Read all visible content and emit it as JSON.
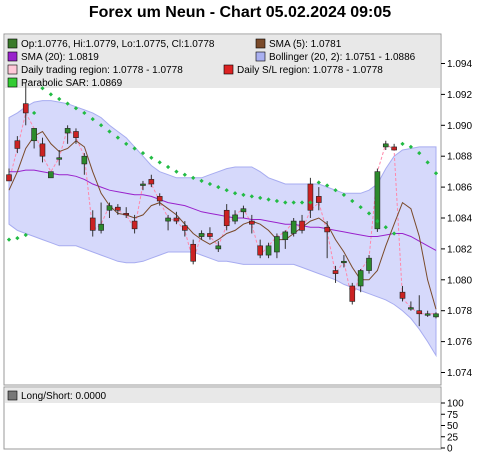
{
  "title": "Forex um Neun - Chart 05.02.2024 09:05",
  "legend": [
    {
      "text": "Op:1.0776, Hi:1.0779, Lo:1.0775, Cl:1.0778",
      "swatch": "#3a7a2a"
    },
    {
      "text": "SMA (5): 1.0781",
      "swatch": "#7a4a2a"
    },
    {
      "text": "SMA (20): 1.0819",
      "swatch": "#9922cc"
    },
    {
      "text": "Bollinger (20, 2): 1.0751 - 1.0886",
      "swatch": "#aab0f0"
    },
    {
      "text": "Daily trading region: 1.0778 - 1.0778",
      "swatch": "#ffc8d8"
    },
    {
      "text": "Daily S/L region: 1.0778 - 1.0778",
      "swatch": "#dd2222"
    },
    {
      "text": "Parabolic SAR: 1.0869",
      "swatch": "#33cc33"
    }
  ],
  "lower_panel": {
    "legend": "Long/Short: 0.0000",
    "swatch": "#777777",
    "y_ticks": [
      "100",
      "75",
      "50",
      "25",
      "0"
    ]
  },
  "chart_data": {
    "type": "candlestick",
    "y_ticks": [
      "1.094",
      "1.092",
      "1.090",
      "1.088",
      "1.086",
      "1.084",
      "1.082",
      "1.080",
      "1.078",
      "1.076",
      "1.074"
    ],
    "ylim": [
      1.074,
      1.0955
    ],
    "candles": [
      {
        "o": 1.0868,
        "h": 1.0872,
        "l": 1.0864,
        "c": 1.0864
      },
      {
        "o": 1.089,
        "h": 1.0893,
        "l": 1.0882,
        "c": 1.0885
      },
      {
        "o": 1.0914,
        "h": 1.0928,
        "l": 1.09,
        "c": 1.0908
      },
      {
        "o": 1.089,
        "h": 1.0896,
        "l": 1.0885,
        "c": 1.0898
      },
      {
        "o": 1.0888,
        "h": 1.0892,
        "l": 1.0876,
        "c": 1.088
      },
      {
        "o": 1.0866,
        "h": 1.087,
        "l": 1.0866,
        "c": 1.087
      },
      {
        "o": 1.0878,
        "h": 1.0884,
        "l": 1.0874,
        "c": 1.0879
      },
      {
        "o": 1.0895,
        "h": 1.09,
        "l": 1.0888,
        "c": 1.0898
      },
      {
        "o": 1.0896,
        "h": 1.0898,
        "l": 1.0888,
        "c": 1.0892
      },
      {
        "o": 1.0875,
        "h": 1.0882,
        "l": 1.0868,
        "c": 1.088
      },
      {
        "o": 1.084,
        "h": 1.0845,
        "l": 1.0828,
        "c": 1.0832
      },
      {
        "o": 1.0832,
        "h": 1.085,
        "l": 1.083,
        "c": 1.0836
      },
      {
        "o": 1.0845,
        "h": 1.085,
        "l": 1.084,
        "c": 1.0848
      },
      {
        "o": 1.0847,
        "h": 1.0849,
        "l": 1.0842,
        "c": 1.0845
      },
      {
        "o": 1.0843,
        "h": 1.0847,
        "l": 1.084,
        "c": 1.0842
      },
      {
        "o": 1.0838,
        "h": 1.0842,
        "l": 1.083,
        "c": 1.0833
      },
      {
        "o": 1.0862,
        "h": 1.0864,
        "l": 1.0858,
        "c": 1.0862
      },
      {
        "o": 1.0865,
        "h": 1.0868,
        "l": 1.086,
        "c": 1.0862
      },
      {
        "o": 1.0854,
        "h": 1.0856,
        "l": 1.0848,
        "c": 1.0851
      },
      {
        "o": 1.0838,
        "h": 1.0842,
        "l": 1.0832,
        "c": 1.084
      },
      {
        "o": 1.084,
        "h": 1.0844,
        "l": 1.0836,
        "c": 1.0838
      },
      {
        "o": 1.0835,
        "h": 1.0838,
        "l": 1.0828,
        "c": 1.0832
      },
      {
        "o": 1.0823,
        "h": 1.0826,
        "l": 1.081,
        "c": 1.0812
      },
      {
        "o": 1.0828,
        "h": 1.0832,
        "l": 1.0826,
        "c": 1.083
      },
      {
        "o": 1.083,
        "h": 1.0834,
        "l": 1.0826,
        "c": 1.0828
      },
      {
        "o": 1.082,
        "h": 1.0825,
        "l": 1.0818,
        "c": 1.0822
      },
      {
        "o": 1.0845,
        "h": 1.0849,
        "l": 1.0832,
        "c": 1.0835
      },
      {
        "o": 1.0838,
        "h": 1.0845,
        "l": 1.0836,
        "c": 1.0842
      },
      {
        "o": 1.0844,
        "h": 1.0848,
        "l": 1.084,
        "c": 1.0846
      },
      {
        "o": 1.0838,
        "h": 1.0842,
        "l": 1.083,
        "c": 1.0836
      },
      {
        "o": 1.0822,
        "h": 1.0826,
        "l": 1.0814,
        "c": 1.0816
      },
      {
        "o": 1.0816,
        "h": 1.0824,
        "l": 1.0814,
        "c": 1.0822
      },
      {
        "o": 1.0818,
        "h": 1.083,
        "l": 1.0814,
        "c": 1.0828
      },
      {
        "o": 1.0826,
        "h": 1.0832,
        "l": 1.082,
        "c": 1.0831
      },
      {
        "o": 1.083,
        "h": 1.084,
        "l": 1.0828,
        "c": 1.0838
      },
      {
        "o": 1.0838,
        "h": 1.0842,
        "l": 1.083,
        "c": 1.0832
      },
      {
        "o": 1.0862,
        "h": 1.0866,
        "l": 1.084,
        "c": 1.0845
      },
      {
        "o": 1.0854,
        "h": 1.086,
        "l": 1.0845,
        "c": 1.085
      },
      {
        "o": 1.0834,
        "h": 1.0838,
        "l": 1.0814,
        "c": 1.0831
      },
      {
        "o": 1.0806,
        "h": 1.0809,
        "l": 1.0798,
        "c": 1.0804
      },
      {
        "o": 1.0812,
        "h": 1.0816,
        "l": 1.0808,
        "c": 1.0812
      },
      {
        "o": 1.0796,
        "h": 1.0798,
        "l": 1.0784,
        "c": 1.0786
      },
      {
        "o": 1.0796,
        "h": 1.0807,
        "l": 1.0792,
        "c": 1.0806
      },
      {
        "o": 1.0806,
        "h": 1.0816,
        "l": 1.0804,
        "c": 1.0814
      },
      {
        "o": 1.0833,
        "h": 1.0872,
        "l": 1.0831,
        "c": 1.087
      },
      {
        "o": 1.0886,
        "h": 1.089,
        "l": 1.0884,
        "c": 1.0888
      },
      {
        "o": 1.0886,
        "h": 1.0888,
        "l": 1.0884,
        "c": 1.0884
      },
      {
        "o": 1.0792,
        "h": 1.0796,
        "l": 1.0786,
        "c": 1.0788
      },
      {
        "o": 1.0782,
        "h": 1.0786,
        "l": 1.078,
        "c": 1.0782
      },
      {
        "o": 1.078,
        "h": 1.079,
        "l": 1.077,
        "c": 1.0778
      },
      {
        "o": 1.0778,
        "h": 1.078,
        "l": 1.0776,
        "c": 1.0778
      },
      {
        "o": 1.0776,
        "h": 1.0779,
        "l": 1.0775,
        "c": 1.0778
      }
    ],
    "sma5": [
      1.0858,
      1.087,
      1.0885,
      1.0893,
      1.0896,
      1.0888,
      1.0883,
      1.0885,
      1.089,
      1.0886,
      1.087,
      1.0856,
      1.0848,
      1.0843,
      1.0842,
      1.084,
      1.0842,
      1.0848,
      1.085,
      1.0846,
      1.0842,
      1.0836,
      1.083,
      1.0826,
      1.0823,
      1.0826,
      1.083,
      1.0832,
      1.0836,
      1.0838,
      1.0836,
      1.0832,
      1.0826,
      1.0826,
      1.083,
      1.0834,
      1.0838,
      1.084,
      1.0836,
      1.0826,
      1.0818,
      1.0808,
      1.08,
      1.08,
      1.0806,
      1.0822,
      1.0836,
      1.085,
      1.0846,
      1.0828,
      1.08,
      1.0781
    ],
    "sma20": [
      1.087,
      1.087,
      1.0871,
      1.0871,
      1.087,
      1.0869,
      1.0868,
      1.0868,
      1.0867,
      1.0865,
      1.0862,
      1.086,
      1.0858,
      1.0857,
      1.0856,
      1.0855,
      1.0855,
      1.0854,
      1.0852,
      1.085,
      1.0849,
      1.0848,
      1.0846,
      1.0844,
      1.0843,
      1.0842,
      1.0841,
      1.084,
      1.084,
      1.0839,
      1.0839,
      1.0838,
      1.0837,
      1.0836,
      1.0836,
      1.0835,
      1.0834,
      1.0834,
      1.0833,
      1.0832,
      1.0831,
      1.083,
      1.0829,
      1.0828,
      1.0828,
      1.0829,
      1.083,
      1.083,
      1.0828,
      1.0825,
      1.0822,
      1.0819
    ],
    "bb_upper": [
      1.0905,
      1.0908,
      1.0912,
      1.0915,
      1.0916,
      1.0916,
      1.0915,
      1.0914,
      1.0912,
      1.091,
      1.0908,
      1.0905,
      1.09,
      1.0896,
      1.0892,
      1.0886,
      1.088,
      1.0874,
      1.087,
      1.0868,
      1.0866,
      1.0866,
      1.0866,
      1.0866,
      1.0868,
      1.087,
      1.0872,
      1.0873,
      1.0873,
      1.0873,
      1.087,
      1.0866,
      1.0864,
      1.0862,
      1.0862,
      1.0862,
      1.0862,
      1.0862,
      1.086,
      1.0858,
      1.0856,
      1.0856,
      1.0856,
      1.0858,
      1.0862,
      1.0872,
      1.088,
      1.0884,
      1.0885,
      1.0886,
      1.0886,
      1.0886
    ],
    "bb_lower": [
      1.0836,
      1.0832,
      1.083,
      1.0828,
      1.0826,
      1.0824,
      1.0822,
      1.0822,
      1.0822,
      1.082,
      1.0818,
      1.0816,
      1.0814,
      1.0812,
      1.0811,
      1.0811,
      1.0812,
      1.0814,
      1.0816,
      1.0818,
      1.0818,
      1.0818,
      1.0818,
      1.0816,
      1.0814,
      1.0812,
      1.0812,
      1.0811,
      1.081,
      1.081,
      1.081,
      1.081,
      1.081,
      1.081,
      1.081,
      1.0808,
      1.0806,
      1.0804,
      1.0802,
      1.08,
      1.0797,
      1.0795,
      1.0793,
      1.0791,
      1.0789,
      1.0787,
      1.0784,
      1.078,
      1.0775,
      1.0768,
      1.076,
      1.0751
    ],
    "sar": [
      1.0826,
      1.0827,
      1.0829,
      1.0908,
      1.0924,
      1.092,
      1.0917,
      1.0914,
      1.0911,
      1.0908,
      1.0904,
      1.09,
      1.0896,
      1.0892,
      1.0888,
      1.0885,
      1.0882,
      1.0879,
      1.0876,
      1.0873,
      1.087,
      1.0868,
      1.0866,
      1.0864,
      1.0862,
      1.086,
      1.0858,
      1.0856,
      1.0855,
      1.0854,
      1.0853,
      1.0852,
      1.0851,
      1.085,
      1.085,
      1.085,
      1.085,
      1.0863,
      1.0861,
      1.0858,
      1.0855,
      1.0851,
      1.0847,
      1.0843,
      1.0838,
      1.0834,
      1.083,
      1.0888,
      1.0886,
      1.0882,
      1.0876,
      1.0869
    ]
  }
}
